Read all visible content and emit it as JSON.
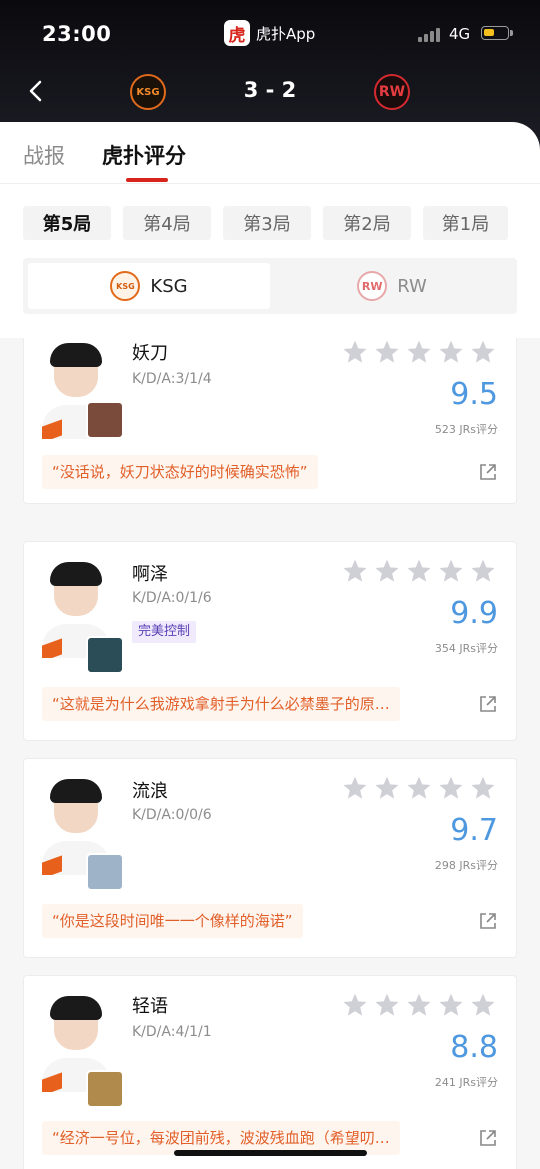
{
  "status": {
    "time": "23:00",
    "app_name": "虎扑App",
    "app_logo_char": "虎",
    "network": "4G"
  },
  "match": {
    "score": "3 - 2",
    "team_left_logo": "KSG",
    "team_right_logo": "RW"
  },
  "tabs": [
    {
      "label": "战报"
    },
    {
      "label": "虎扑评分"
    }
  ],
  "games": [
    {
      "label": "第5局"
    },
    {
      "label": "第4局"
    },
    {
      "label": "第3局"
    },
    {
      "label": "第2局"
    },
    {
      "label": "第1局"
    }
  ],
  "team_select": {
    "left": "KSG",
    "right": "RW"
  },
  "players": [
    {
      "name": "妖刀",
      "kda": "K/D/A:3/1/4",
      "score": "9.5",
      "votes": "523 JRs评分",
      "quote": "“没话说，妖刀状态好的时候确实恐怖”",
      "tag": "",
      "hero_color": "#7a4a3a"
    },
    {
      "name": "啊泽",
      "kda": "K/D/A:0/1/6",
      "score": "9.9",
      "votes": "354 JRs评分",
      "quote": "“这就是为什么我游戏拿射手为什么必禁墨子的原…",
      "tag": "完美控制",
      "hero_color": "#2b4d57"
    },
    {
      "name": "流浪",
      "kda": "K/D/A:0/0/6",
      "score": "9.7",
      "votes": "298 JRs评分",
      "quote": "“你是这段时间唯一一个像样的海诺”",
      "tag": "",
      "hero_color": "#9fb3c8"
    },
    {
      "name": "轻语",
      "kda": "K/D/A:4/1/1",
      "score": "8.8",
      "votes": "241 JRs评分",
      "quote": "“经济一号位，每波团前残，波波残血跑（希望叨…",
      "tag": "",
      "hero_color": "#b08a4c"
    }
  ]
}
